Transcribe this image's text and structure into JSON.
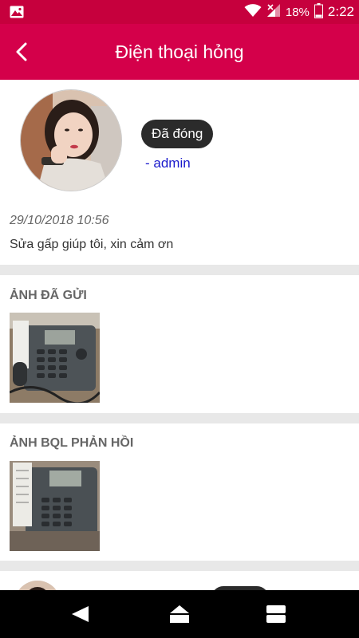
{
  "status_bar": {
    "battery": "18%",
    "time": "2:22",
    "icons": [
      "image-notification-icon",
      "wifi-icon",
      "cellular-signal-icon",
      "battery-icon"
    ]
  },
  "header": {
    "title": "Điện thoại hỏng",
    "back_icon": "chevron-left-icon"
  },
  "ticket": {
    "status": "Đã đóng",
    "assignee": "- admin",
    "timestamp": "29/10/2018 10:56",
    "message": "Sửa gấp giúp tôi, xin cảm ơn"
  },
  "sections": {
    "sent_photos": "ẢNH ĐÃ GỬI",
    "reply_photos": "ẢNH BQL PHẢN HỒI"
  },
  "nav": {
    "icons": [
      "back-icon",
      "home-icon",
      "recents-icon"
    ]
  },
  "colors": {
    "brand": "#d4004a",
    "status_bar": "#c6003d",
    "chip": "#2b2b2b",
    "link": "#1a1acc"
  }
}
